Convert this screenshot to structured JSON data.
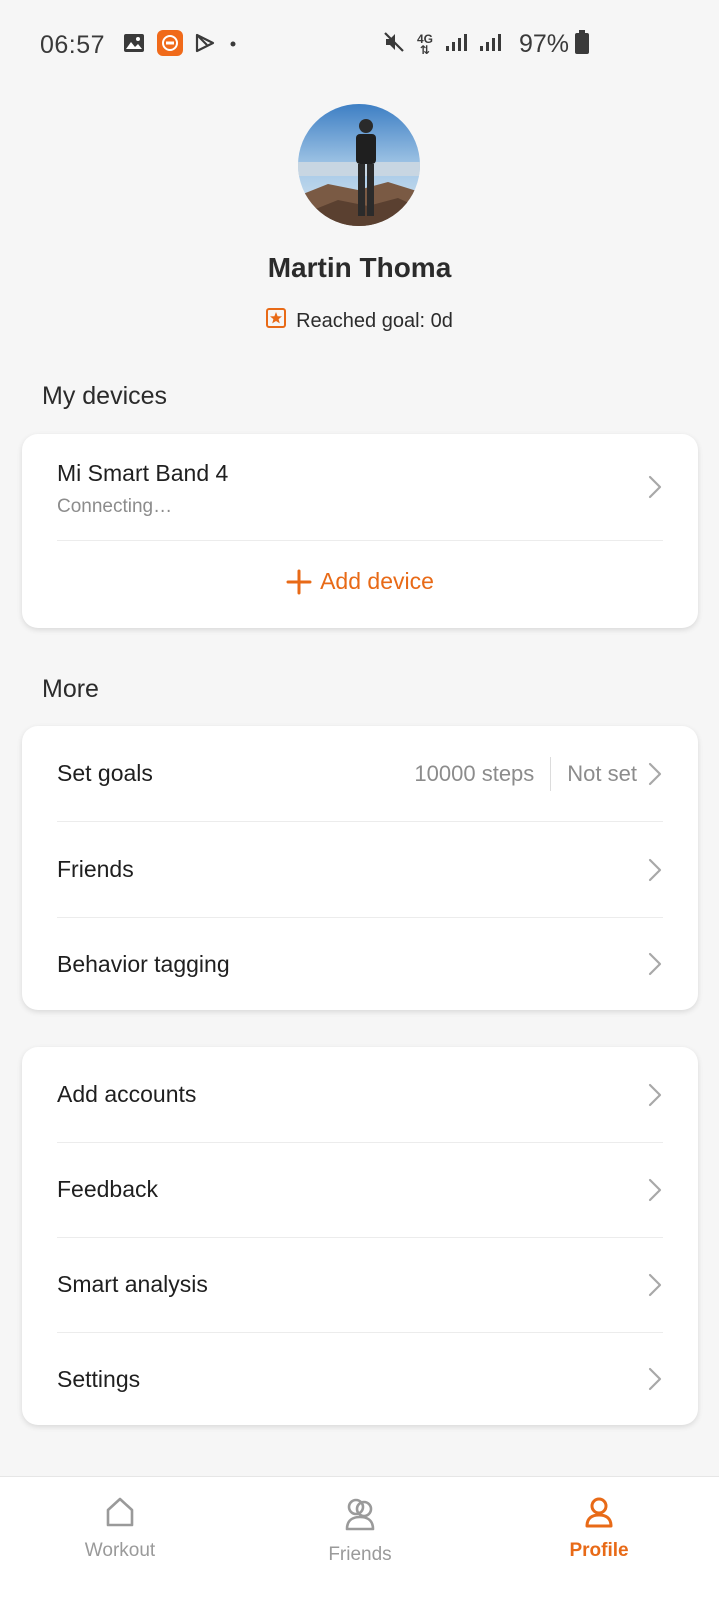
{
  "status_bar": {
    "time": "06:57",
    "battery": "97%",
    "network": "4G",
    "icons": [
      "gallery-icon",
      "app-notification-icon",
      "play-store-icon",
      "dot-icon",
      "mute-icon",
      "signal-icon",
      "battery-icon"
    ]
  },
  "profile": {
    "name": "Martin Thoma",
    "goal_text": "Reached goal: 0d"
  },
  "my_devices": {
    "title": "My devices",
    "device_name": "Mi Smart Band 4",
    "device_status": "Connecting…",
    "add_device_label": "Add device"
  },
  "more": {
    "title": "More",
    "items": [
      {
        "label": "Set goals",
        "steps": "10000 steps",
        "extra": "Not set"
      },
      {
        "label": "Friends"
      },
      {
        "label": "Behavior tagging"
      }
    ]
  },
  "other": {
    "items": [
      {
        "label": "Add accounts"
      },
      {
        "label": "Feedback"
      },
      {
        "label": "Smart analysis"
      },
      {
        "label": "Settings"
      }
    ]
  },
  "nav": {
    "workout": "Workout",
    "friends": "Friends",
    "profile": "Profile"
  },
  "colors": {
    "accent": "#e86a17",
    "muted": "#9a9a9a"
  }
}
